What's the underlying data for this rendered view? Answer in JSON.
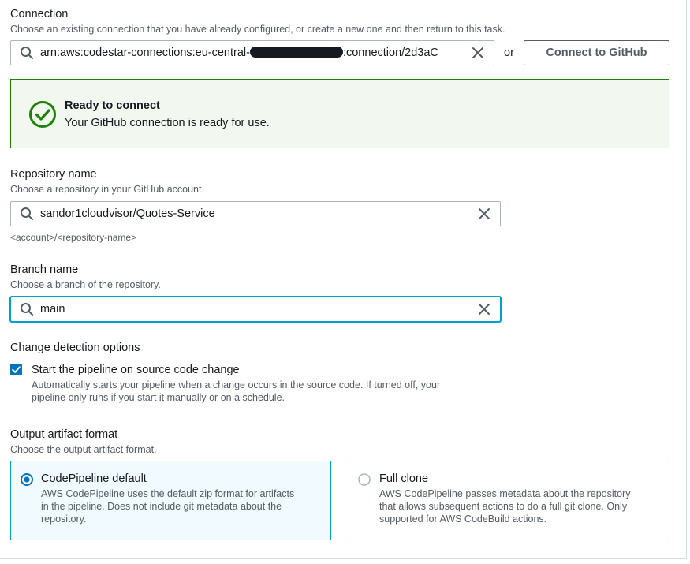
{
  "connection": {
    "label": "Connection",
    "description": "Choose an existing connection that you have already configured, or create a new one and then return to this task.",
    "value_prefix": "arn:aws:codestar-connections:eu-central-",
    "value_suffix": ":connection/2d3aC",
    "or_text": "or",
    "connect_button": "Connect to GitHub"
  },
  "alert": {
    "title": "Ready to connect",
    "message": "Your GitHub connection is ready for use."
  },
  "repository": {
    "label": "Repository name",
    "description": "Choose a repository in your GitHub account.",
    "value": "sandor1cloudvisor/Quotes-Service",
    "hint": "<account>/<repository-name>"
  },
  "branch": {
    "label": "Branch name",
    "description": "Choose a branch of the repository.",
    "value": "main"
  },
  "change_detection": {
    "label": "Change detection options",
    "checkbox_label": "Start the pipeline on source code change",
    "checkbox_description_line1": "Automatically starts your pipeline when a change occurs in the source code. If turned off, your",
    "checkbox_description_line2": "pipeline only runs if you start it manually or on a schedule.",
    "checked": true
  },
  "output_artifact": {
    "label": "Output artifact format",
    "description": "Choose the output artifact format.",
    "options": [
      {
        "title": "CodePipeline default",
        "line1": "AWS CodePipeline uses the default zip format for artifacts",
        "line2": "in the pipeline. Does not include git metadata about the",
        "line3": "repository.",
        "selected": true
      },
      {
        "title": "Full clone",
        "line1": "AWS CodePipeline passes metadata about the repository",
        "line2": "that allows subsequent actions to do a full git clone. Only",
        "line3": "supported for AWS CodeBuild actions.",
        "selected": false
      }
    ]
  },
  "colors": {
    "accent": "#0073bb",
    "focus": "#00a1c9",
    "success": "#1d8102",
    "text": "#16191f",
    "muted": "#545b64"
  }
}
